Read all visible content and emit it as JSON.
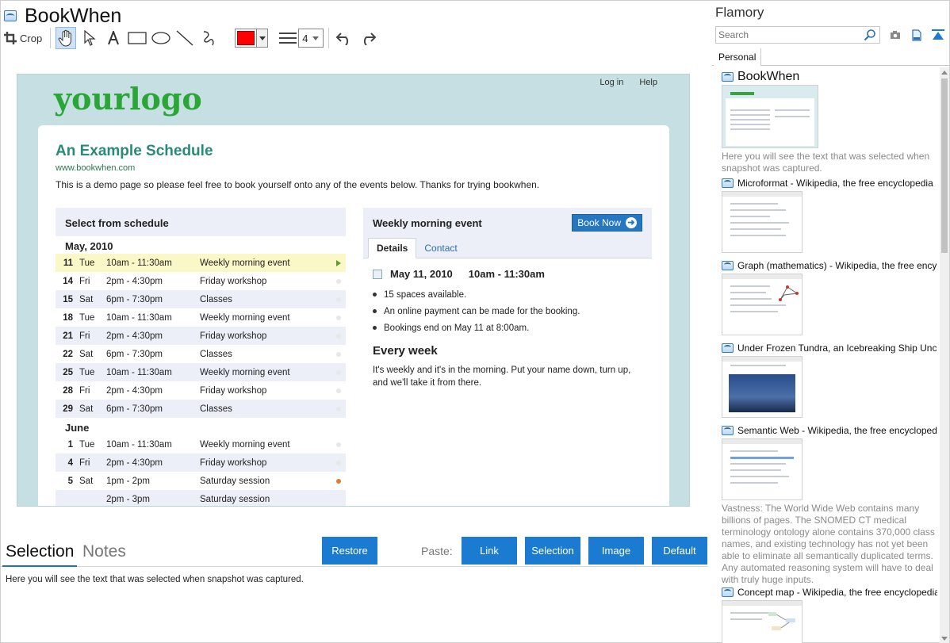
{
  "document": {
    "title": "BookWhen"
  },
  "toolbar": {
    "crop_label": "Crop",
    "line_width": "4",
    "color": "#ff0000"
  },
  "snapshot": {
    "logo": "yourlogo",
    "nav": [
      "Log in",
      "Help"
    ],
    "heading": "An Example Schedule",
    "url": "www.bookwhen.com",
    "intro": "This is a demo page so please feel free to book yourself onto any of the events below. Thanks for trying bookwhen.",
    "schedule_title": "Select from schedule",
    "months": [
      {
        "label": "May, 2010",
        "rows": [
          {
            "day": "11",
            "weekday": "Tue",
            "time": "10am - 11:30am",
            "event": "Weekly morning event"
          },
          {
            "day": "14",
            "weekday": "Fri",
            "time": "2pm - 4:30pm",
            "event": "Friday workshop"
          },
          {
            "day": "15",
            "weekday": "Sat",
            "time": "6pm - 7:30pm",
            "event": "Classes"
          },
          {
            "day": "18",
            "weekday": "Tue",
            "time": "10am - 11:30am",
            "event": "Weekly morning event"
          },
          {
            "day": "21",
            "weekday": "Fri",
            "time": "2pm - 4:30pm",
            "event": "Friday workshop"
          },
          {
            "day": "22",
            "weekday": "Sat",
            "time": "6pm - 7:30pm",
            "event": "Classes"
          },
          {
            "day": "25",
            "weekday": "Tue",
            "time": "10am - 11:30am",
            "event": "Weekly morning event"
          },
          {
            "day": "28",
            "weekday": "Fri",
            "time": "2pm - 4:30pm",
            "event": "Friday workshop"
          },
          {
            "day": "29",
            "weekday": "Sat",
            "time": "6pm - 7:30pm",
            "event": "Classes"
          }
        ]
      },
      {
        "label": "June",
        "rows": [
          {
            "day": "1",
            "weekday": "Tue",
            "time": "10am - 11:30am",
            "event": "Weekly morning event"
          },
          {
            "day": "4",
            "weekday": "Fri",
            "time": "2pm - 4:30pm",
            "event": "Friday workshop"
          },
          {
            "day": "5",
            "weekday": "Sat",
            "time": "1pm - 2pm",
            "event": "Saturday session"
          },
          {
            "day": "",
            "weekday": "",
            "time": "2pm - 3pm",
            "event": "Saturday session"
          }
        ]
      }
    ],
    "event": {
      "title": "Weekly morning event",
      "book_now": "Book Now",
      "tabs": [
        "Details",
        "Contact"
      ],
      "date": "May 11, 2010",
      "time": "10am - 11:30am",
      "bullets": [
        "15 spaces available.",
        "An online payment can be made for the booking.",
        "Bookings end on May 11 at 8:00am."
      ],
      "subheading": "Every week",
      "description": "It's weekly and it's in the morning. Put your name down, turn up, and we'll take it from there."
    }
  },
  "bottom": {
    "tabs": [
      "Selection",
      "Notes"
    ],
    "restore": "Restore",
    "paste_label": "Paste:",
    "paste_buttons": [
      "Link",
      "Selection",
      "Image",
      "Default"
    ],
    "selected_text": "Here you will see the text that was selected when snapshot was captured."
  },
  "sidebar": {
    "title": "Flamory",
    "search_placeholder": "Search",
    "tab": "Personal",
    "items": [
      {
        "title": "BookWhen",
        "caption": "Here you will see the text that was selected when snapshot was captured."
      },
      {
        "title": "Microformat - Wikipedia, the free encyclopedia",
        "caption": ""
      },
      {
        "title": "Graph (mathematics) - Wikipedia, the free ency",
        "caption": ""
      },
      {
        "title": "Under Frozen Tundra, an Icebreaking Ship Unco",
        "caption": ""
      },
      {
        "title": "Semantic Web - Wikipedia, the free encycloped",
        "caption": "Vastness: The World Wide Web contains many billions of pages. The SNOMED CT medical terminology ontology alone contains 370,000 class names, and existing technology has not yet been able to eliminate all semantically duplicated terms. Any automated reasoning system will have to deal with truly huge inputs."
      },
      {
        "title": "Concept map - Wikipedia, the free encyclopedia",
        "caption": ""
      }
    ]
  }
}
